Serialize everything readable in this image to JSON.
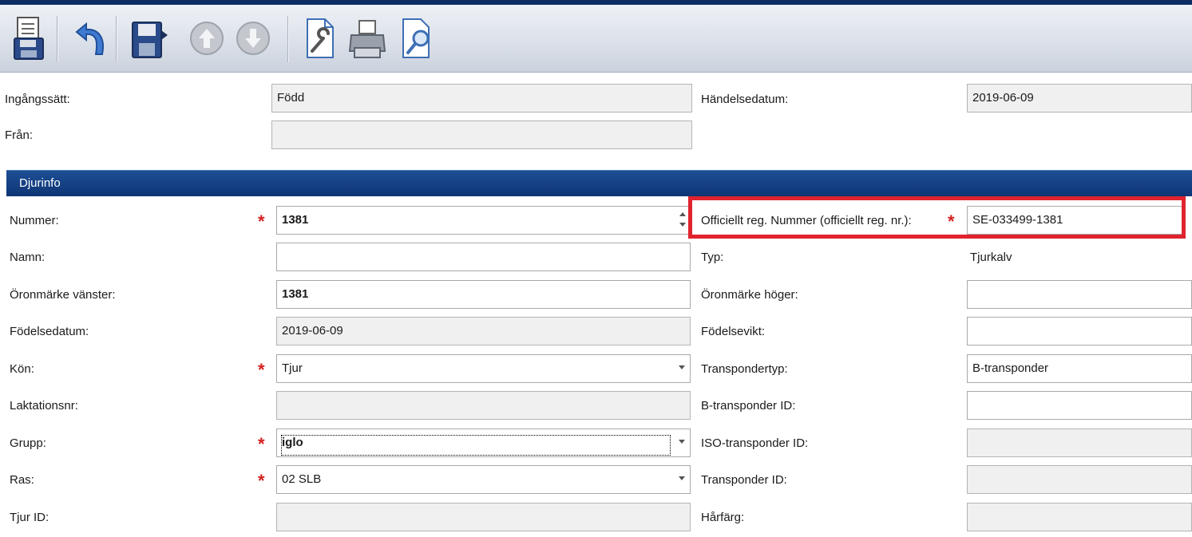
{
  "toolbar": {
    "icons": [
      "save-list-icon",
      "undo-icon",
      "save-next-icon",
      "up-icon",
      "down-icon",
      "settings-doc-icon",
      "print-icon",
      "preview-icon"
    ]
  },
  "top": {
    "entry_label": "Ingångssätt:",
    "entry_value": "Född",
    "from_label": "Från:",
    "from_value": "",
    "event_date_label": "Händelsedatum:",
    "event_date_value": "2019-06-09"
  },
  "section": {
    "title": "Djurinfo"
  },
  "left": {
    "nummer_label": "Nummer:",
    "nummer_value": "1381",
    "namn_label": "Namn:",
    "namn_value": "",
    "ear_left_label": "Öronmärke vänster:",
    "ear_left_value": "1381",
    "birthdate_label": "Födelsedatum:",
    "birthdate_value": "2019-06-09",
    "sex_label": "Kön:",
    "sex_value": "Tjur",
    "lactation_label": "Laktationsnr:",
    "lactation_value": "",
    "group_label": "Grupp:",
    "group_value": "iglo",
    "breed_label": "Ras:",
    "breed_value": "02 SLB",
    "bull_label": "Tjur ID:",
    "bull_value": ""
  },
  "right": {
    "official_label": "Officiellt reg. Nummer (officiellt reg. nr.):",
    "official_value": "SE-033499-1381",
    "type_label": "Typ:",
    "type_value": "Tjurkalv",
    "ear_right_label": "Öronmärke höger:",
    "ear_right_value": "",
    "birthweight_label": "Födelsevikt:",
    "birthweight_value": "",
    "transponder_type_label": "Transpondertyp:",
    "transponder_type_value": "B-transponder",
    "b_id_label": "B-transponder ID:",
    "b_id_value": "",
    "iso_id_label": "ISO-transponder ID:",
    "iso_id_value": "",
    "transponder_id_label": "Transponder ID:",
    "transponder_id_value": "",
    "hair_label": "Hårfärg:",
    "hair_value": ""
  },
  "required_mark": "*",
  "colors": {
    "header": "#0e3575",
    "required": "#d42020",
    "highlight": "#e0232e"
  }
}
